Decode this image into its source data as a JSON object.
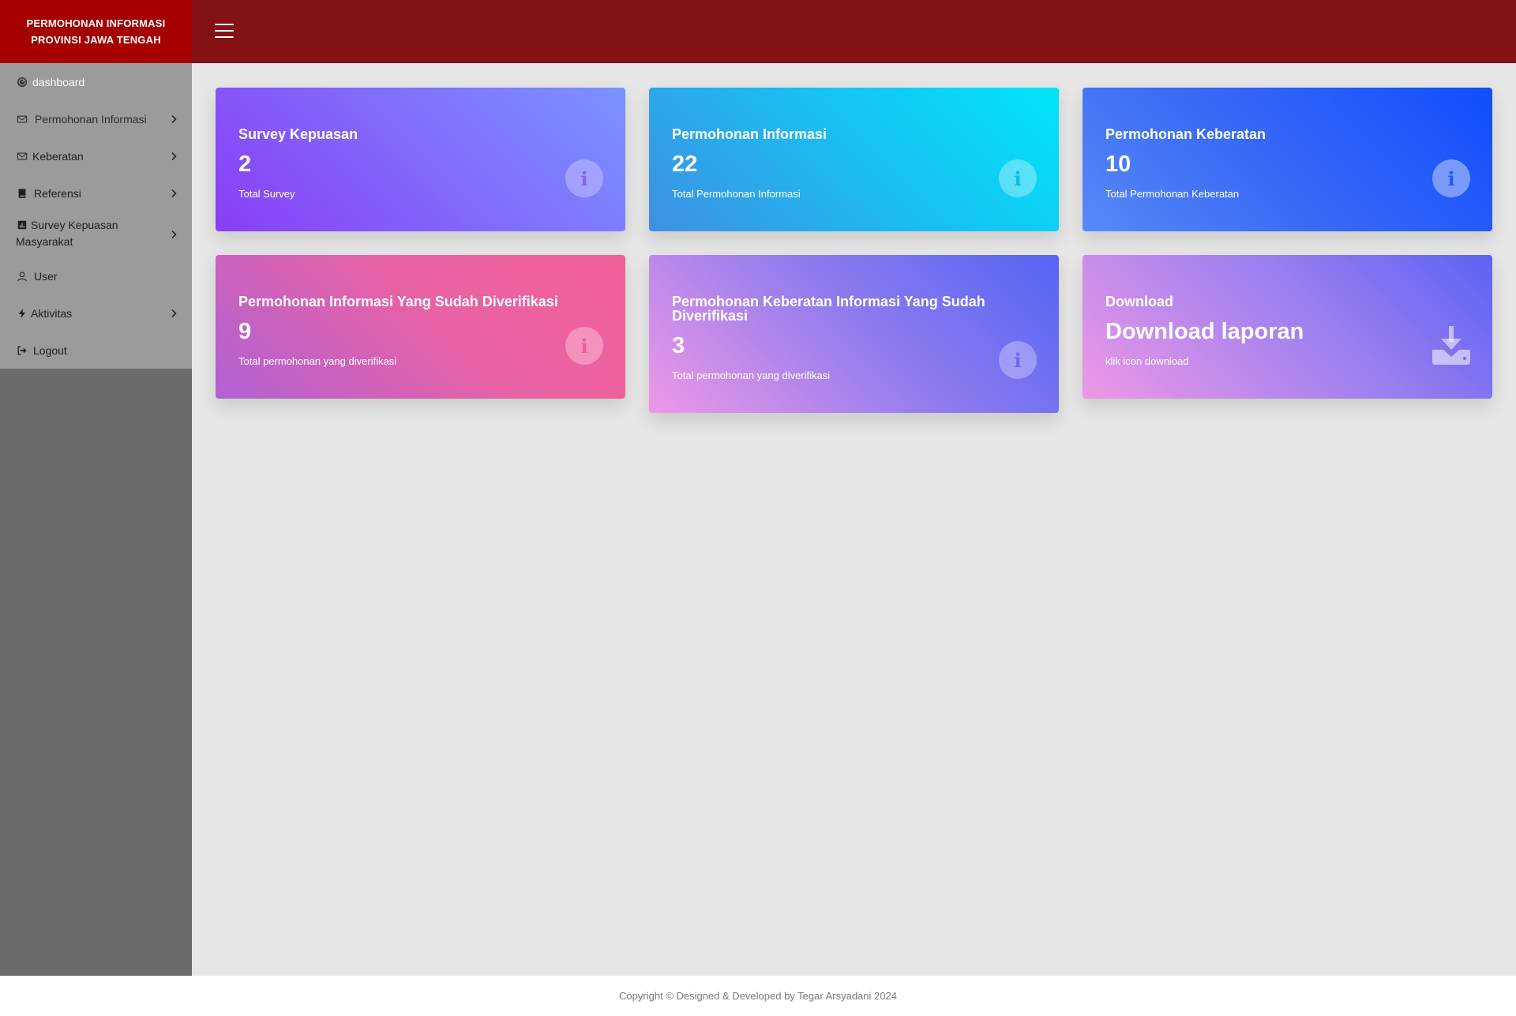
{
  "brand": {
    "line1": "PERMOHONAN INFORMASI",
    "line2": "PROVINSI JAWA TENGAH"
  },
  "sidebar": {
    "items": [
      {
        "label": "dashboard",
        "icon": "dashboard-icon"
      },
      {
        "label": "Permohonan Informasi",
        "icon": "envelope-icon"
      },
      {
        "label": "Keberatan",
        "icon": "envelope-icon"
      },
      {
        "label": "Referensi",
        "icon": "book-icon"
      },
      {
        "label": "Survey Kepuasan Masyarakat",
        "icon": "chart-icon"
      },
      {
        "label": "User",
        "icon": "user-icon"
      },
      {
        "label": "Aktivitas",
        "icon": "bolt-icon"
      },
      {
        "label": "Logout",
        "icon": "logout-icon"
      }
    ]
  },
  "cards": [
    {
      "title": "Survey Kepuasan",
      "value": "2",
      "subtitle": "Total Survey",
      "icon": "info-icon"
    },
    {
      "title": "Permohonan Informasi",
      "value": "22",
      "subtitle": "Total Permohonan Informasi",
      "icon": "info-icon"
    },
    {
      "title": "Permohonan Keberatan",
      "value": "10",
      "subtitle": "Total Permohonan Keberatan",
      "icon": "info-icon"
    },
    {
      "title": "Permohonan Informasi Yang Sudah Diverifikasi",
      "value": "9",
      "subtitle": "Total permohonan yang diverifikasi",
      "icon": "info-icon"
    },
    {
      "title": "Permohonan Keberatan Informasi Yang Sudah Diverifikasi",
      "value": "3",
      "subtitle": "Total permohonan yang diverifikasi",
      "icon": "info-icon"
    },
    {
      "title": "Download",
      "value": "Download laporan",
      "subtitle": "klik icon download",
      "icon": "download-icon"
    }
  ],
  "footer": {
    "text": "Copyright © Designed & Developed by Tegar Arsyadani 2024"
  }
}
